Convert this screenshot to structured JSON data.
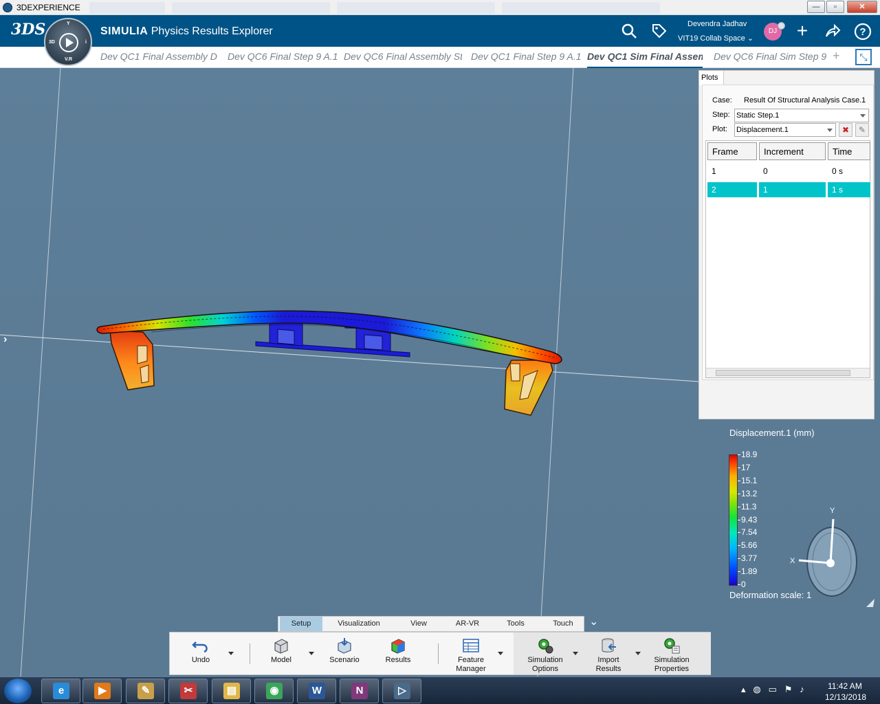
{
  "window": {
    "title": "3DEXPERIENCE",
    "minimize": "—",
    "maximize": "▫",
    "close": "✕"
  },
  "appbar": {
    "logo": "3DS",
    "compass_labels": {
      "top": "Y",
      "left": "3D",
      "right": "i",
      "bottom": "V.R"
    },
    "brand": "SIMULIA",
    "app_name": "Physics Results Explorer",
    "user_name": "Devendra Jadhav",
    "collab_space": "VIT19 Collab Space",
    "avatar_initials": "DJ",
    "icons": [
      "search-icon",
      "tag-icon",
      "add-icon",
      "share-icon",
      "help-icon"
    ]
  },
  "tabs": {
    "items": [
      {
        "label": "Dev QC1 Final Assembly D",
        "active": false
      },
      {
        "label": "Dev QC6 Final Step 9 A.1",
        "active": false
      },
      {
        "label": "Dev QC6 Final Assembly St",
        "active": false
      },
      {
        "label": "Dev QC1 Final Step 9 A.1",
        "active": false
      },
      {
        "label": "Dev QC1 Sim Final Assem",
        "active": true
      },
      {
        "label": "Dev QC6 Final Sim Step 9",
        "active": false
      }
    ],
    "add": "+"
  },
  "plots_panel": {
    "tab_label": "Plots",
    "case_label": "Case:",
    "case_value": "Result Of Structural Analysis Case.1",
    "step_label": "Step:",
    "step_value": "Static Step.1",
    "plot_label": "Plot:",
    "plot_value": "Displacement.1",
    "table": {
      "headers": [
        "Frame",
        "Increment",
        "Time"
      ],
      "rows": [
        {
          "frame": "1",
          "increment": "0",
          "time": "0 s",
          "selected": false
        },
        {
          "frame": "2",
          "increment": "1",
          "time": "1 s",
          "selected": true
        }
      ]
    }
  },
  "legend": {
    "title": "Displacement.1 (mm)",
    "ticks": [
      "18.9",
      "17",
      "15.1",
      "13.2",
      "11.3",
      "9.43",
      "7.54",
      "5.66",
      "3.77",
      "1.89",
      "0"
    ],
    "deformation_scale": "Deformation scale: 1"
  },
  "triad": {
    "y": "Y",
    "x": "X"
  },
  "ribbon": {
    "tabs": [
      {
        "label": "Setup",
        "active": true
      },
      {
        "label": "Visualization",
        "active": false
      },
      {
        "label": "View",
        "active": false
      },
      {
        "label": "AR-VR",
        "active": false
      },
      {
        "label": "Tools",
        "active": false
      },
      {
        "label": "Touch",
        "active": false
      }
    ],
    "commands": [
      {
        "line1": "Undo",
        "line2": "",
        "icon": "undo-icon"
      },
      {
        "line1": "Model",
        "line2": "",
        "icon": "model-icon"
      },
      {
        "line1": "Scenario",
        "line2": "",
        "icon": "scenario-icon"
      },
      {
        "line1": "Results",
        "line2": "",
        "icon": "results-icon"
      },
      {
        "line1": "Feature",
        "line2": "Manager",
        "icon": "feature-manager-icon"
      },
      {
        "line1": "Simulation",
        "line2": "Options",
        "icon": "simulation-options-icon"
      },
      {
        "line1": "Import",
        "line2": "Results",
        "icon": "import-results-icon"
      },
      {
        "line1": "Simulation",
        "line2": "Properties",
        "icon": "simulation-properties-icon"
      }
    ]
  },
  "taskbar": {
    "apps": [
      {
        "name": "internet-explorer",
        "glyph": "e",
        "color": "#2a8bd9"
      },
      {
        "name": "media-player",
        "glyph": "▶",
        "color": "#e07a1a"
      },
      {
        "name": "paint",
        "glyph": "✎",
        "color": "#c9a04a"
      },
      {
        "name": "snipping-tool",
        "glyph": "✂",
        "color": "#c23a3a"
      },
      {
        "name": "file-explorer",
        "glyph": "▤",
        "color": "#e0b84a"
      },
      {
        "name": "chrome",
        "glyph": "◉",
        "color": "#3aa65a"
      },
      {
        "name": "word",
        "glyph": "W",
        "color": "#2b5797"
      },
      {
        "name": "onenote",
        "glyph": "N",
        "color": "#80397b"
      },
      {
        "name": "3dexperience",
        "glyph": "▷",
        "color": "#4a6a8a"
      }
    ],
    "time": "11:42 AM",
    "date": "12/13/2018"
  },
  "colors": {
    "brand_blue": "#005386",
    "viewport_bg": "#5e7f99",
    "selection": "#00c4c9"
  }
}
